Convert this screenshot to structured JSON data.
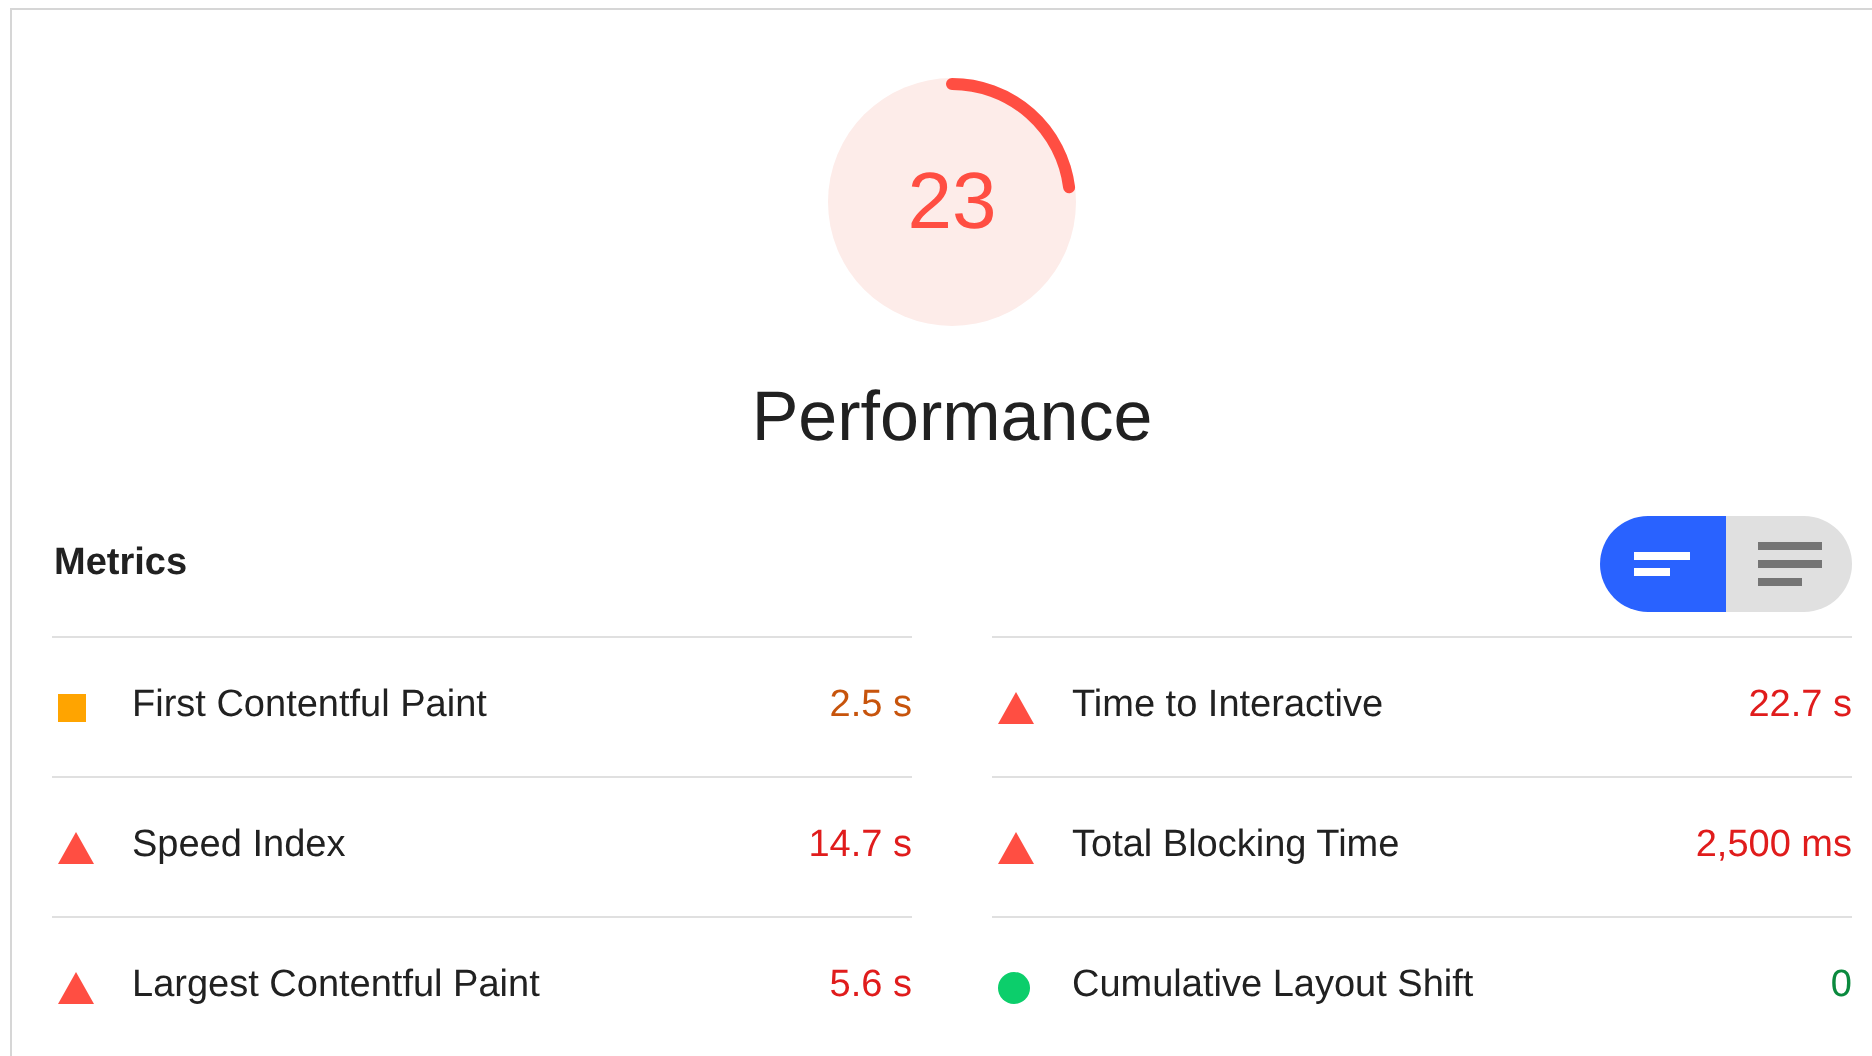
{
  "gauge": {
    "score": "23"
  },
  "category_title": "Performance",
  "metrics_heading": "Metrics",
  "view_toggle": [
    {
      "kind": "summary",
      "selected": true
    },
    {
      "kind": "detailed",
      "selected": false
    }
  ],
  "metrics": [
    {
      "name": "First Contentful Paint",
      "value": "2.5 s",
      "kind": "square",
      "color": "#ffa400"
    },
    {
      "name": "Time to Interactive",
      "value": "22.7 s",
      "kind": "triangle",
      "color": "#ff4e42"
    },
    {
      "name": "Speed Index",
      "value": "14.7 s",
      "kind": "triangle",
      "color": "#ff4e42"
    },
    {
      "name": "Total Blocking Time",
      "value": "2,500 ms",
      "kind": "triangle",
      "color": "#ff4e42"
    },
    {
      "name": "Largest Contentful Paint",
      "value": "5.6 s",
      "kind": "triangle",
      "color": "#ff4e42"
    },
    {
      "name": "Cumulative Layout Shift",
      "value": "0",
      "kind": "circle",
      "color": "#0cce6b"
    }
  ]
}
